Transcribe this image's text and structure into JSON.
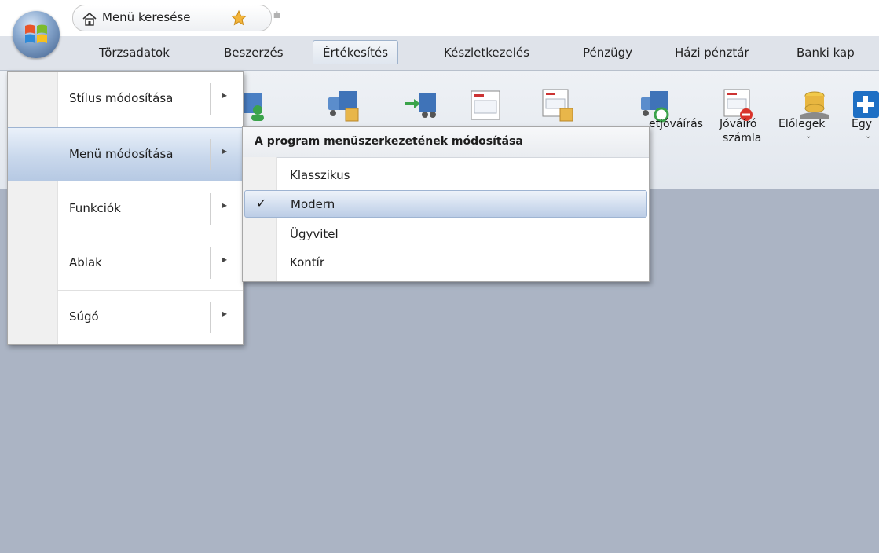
{
  "quick_access": {
    "search_label": "Menü keresése",
    "customize_glyph": "⩧"
  },
  "tabs": [
    {
      "label": "Törzsadatok"
    },
    {
      "label": "Beszerzés"
    },
    {
      "label": "Értékesítés",
      "active": true
    },
    {
      "label": "Készletkezelés"
    },
    {
      "label": "Pénzügy"
    },
    {
      "label": "Házi pénztár"
    },
    {
      "label": "Banki kap"
    }
  ],
  "ribbon": {
    "labels": {
      "credit_partial": "etjóváírás",
      "credit_invoice_line1": "Jóváíró",
      "credit_invoice_line2": "számla",
      "advances": "Előlegek",
      "other": "Egy",
      "dropdown_glyph": "⌄"
    }
  },
  "app_menu": {
    "items": [
      {
        "label": "Stílus módosítása"
      },
      {
        "label": "Menü módosítása",
        "highlighted": true
      },
      {
        "label": "Funkciók"
      },
      {
        "label": "Ablak"
      },
      {
        "label": "Súgó"
      }
    ],
    "arrow_glyph": "▸"
  },
  "submenu": {
    "header": "A program menüszerkezetének módosítása",
    "items": [
      {
        "label": "Klasszikus"
      },
      {
        "label": "Modern",
        "checked": true
      },
      {
        "label": "Ügyvitel"
      },
      {
        "label": "Kontír"
      }
    ],
    "check_glyph": "✓"
  },
  "colors": {
    "workspace": "#abb4c4",
    "ribbon": "#e6eaf0",
    "tabbar": "#dfe3ea",
    "highlight": "#c9d8ec",
    "accent_blue": "#1e6fc4"
  }
}
